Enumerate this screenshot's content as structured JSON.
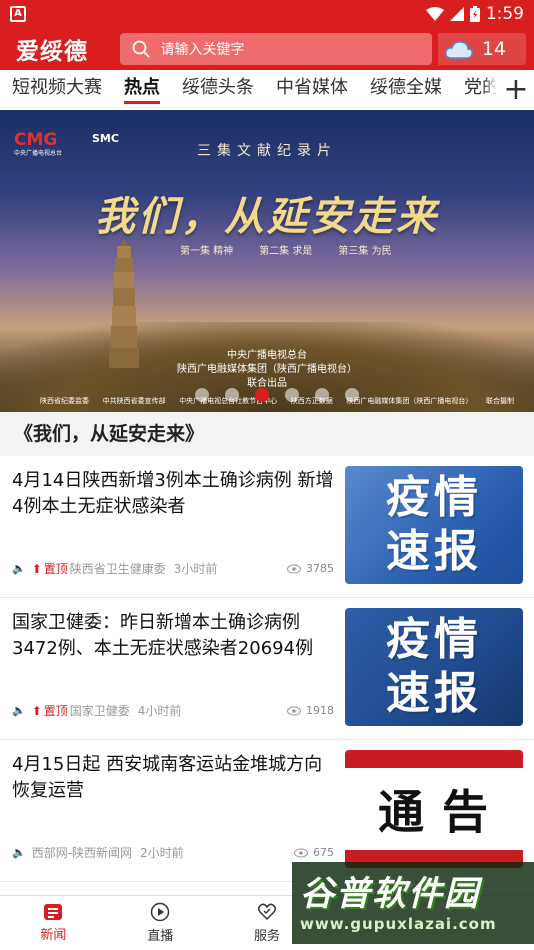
{
  "status_bar": {
    "badge": "A",
    "time": "1:59"
  },
  "header": {
    "logo_text": "爱绥德",
    "search_placeholder": "请输入关键字",
    "weather_temp": "14"
  },
  "tabs": [
    "短视频大赛",
    "热点",
    "绥德头条",
    "中省媒体",
    "绥德全媒",
    "党的"
  ],
  "active_tab": "热点",
  "add_tab_label": "+",
  "banner": {
    "doc_label": "三集文献纪录片",
    "title": "我们，从延安走来",
    "episodes": [
      "第一集 精神",
      "第二集 求是",
      "第三集 为民"
    ],
    "org_cmg": "CMG",
    "org_cmg_sub": "中央广播电视总台",
    "org_smc": "SMC",
    "credit_line1": "中央广播电视总台",
    "credit_line2": "陕西广电融媒体集团（陕西广播电视台）",
    "credit_line3": "联合出品",
    "bottom_credits": [
      "陕西省纪委监委",
      "中共陕西省委宣传部",
      "中央广播电视总台社教节目中心",
      "陕西方正数据",
      "陕西广电融媒体集团（陕西广播电视台）",
      "联合摄制"
    ],
    "slide_count": 6,
    "active_slide": 3
  },
  "banner_caption": "《我们，从延安走来》",
  "news": [
    {
      "title": "4月14日陕西新增3例本土确诊病例 新增4例本土无症状感染者",
      "pinned_label": "置顶",
      "source": "陕西省卫生健康委",
      "time": "3小时前",
      "views": "3785",
      "thumb_lines": [
        "疫情",
        "速报"
      ]
    },
    {
      "title": "国家卫健委：昨日新增本土确诊病例3472例、本土无症状感染者20694例",
      "pinned_label": "置顶",
      "source": "国家卫健委",
      "time": "4小时前",
      "views": "1918",
      "thumb_lines": [
        "疫情",
        "速报"
      ]
    },
    {
      "title": "4月15日起 西安城南客运站金堆城方向恢复运营",
      "pinned_label": "",
      "source": "西部网-陕西新闻网",
      "time": "2小时前",
      "views": "675",
      "thumb_lines": [
        "通告"
      ]
    }
  ],
  "bottom_nav": [
    {
      "label": "新闻",
      "icon": "news-icon",
      "active": true
    },
    {
      "label": "直播",
      "icon": "play-icon",
      "active": false
    },
    {
      "label": "服务",
      "icon": "service-icon",
      "active": false
    },
    {
      "label": "",
      "icon": "hidden-icon",
      "active": false
    },
    {
      "label": "",
      "icon": "hidden-icon",
      "active": false
    }
  ],
  "watermark": {
    "title": "谷普软件园",
    "url": "www.gupuxlazai.com"
  },
  "colors": {
    "brand_red": "#d81e1e",
    "search_bg": "#ef6c6c"
  }
}
